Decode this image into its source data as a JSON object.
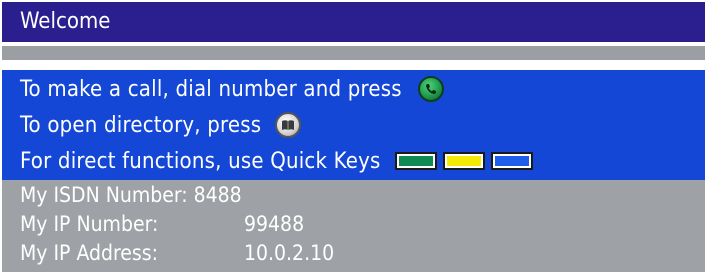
{
  "title": "Welcome",
  "instructions": [
    {
      "text": "To make a call, dial number and press",
      "icon": "call-button-icon"
    },
    {
      "text": "To open directory, press",
      "icon": "directory-button-icon"
    },
    {
      "text": "For direct functions, use Quick Keys",
      "icon": "quick-keys"
    }
  ],
  "quick_keys": {
    "colors": [
      "#0f8a55",
      "#f5ea06",
      "#1e5ee8"
    ]
  },
  "info": {
    "isdn_label": "My ISDN Number:",
    "isdn_value": "8488",
    "ip_number_label": "My IP Number:",
    "ip_number_value": "99488",
    "ip_address_label": "My IP Address:",
    "ip_address_value": "10.0.2.10"
  },
  "colors": {
    "title_bar": "#2b1f8f",
    "instruction_band": "#1447d6",
    "info_band": "#9ea1a5"
  }
}
